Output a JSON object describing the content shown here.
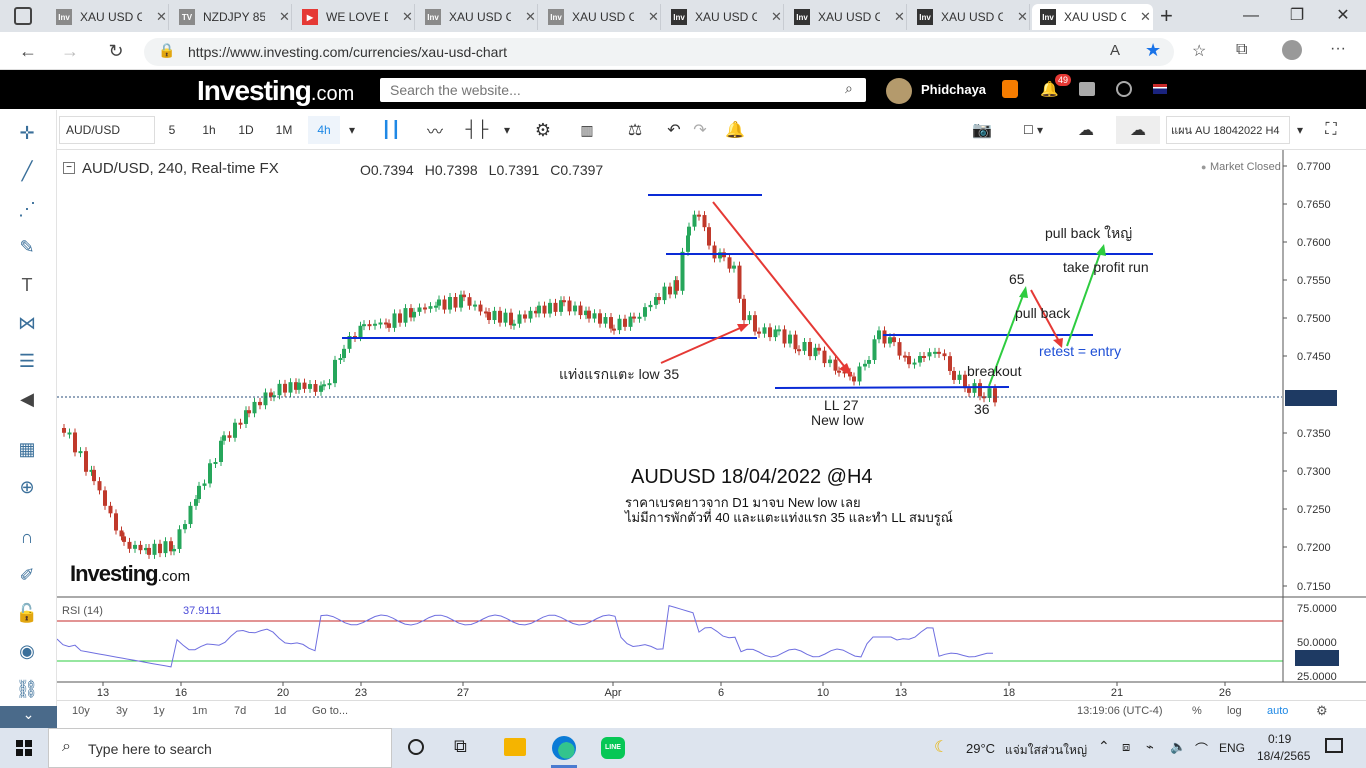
{
  "tabs": [
    {
      "label": "XAU USD C",
      "icon": "inv-icon",
      "color": "#8a8a8a"
    },
    {
      "label": "NZDJPY 85",
      "icon": "tv-icon",
      "color": "#8a8a8a"
    },
    {
      "label": "WE LOVE D",
      "icon": "youtube-icon",
      "color": "#e53935"
    },
    {
      "label": "XAU USD C",
      "icon": "inv-icon",
      "color": "#8a8a8a"
    },
    {
      "label": "XAU USD C",
      "icon": "inv-icon",
      "color": "#8a8a8a"
    },
    {
      "label": "XAU USD C",
      "icon": "inv-icon",
      "color": "#333333"
    },
    {
      "label": "XAU USD C",
      "icon": "inv-icon",
      "color": "#333333"
    },
    {
      "label": "XAU USD C",
      "icon": "inv-icon",
      "color": "#333333"
    },
    {
      "label": "XAU USD C",
      "icon": "inv-icon",
      "color": "#333333"
    }
  ],
  "browser": {
    "url": "https://www.investing.com/currencies/xau-usd-chart"
  },
  "site": {
    "logo_main": "Investing",
    "logo_suffix": ".com",
    "search_placeholder": "Search the website...",
    "username": "Phidchaya",
    "notif_count": "49"
  },
  "toolbar": {
    "symbol": "AUD/USD",
    "intervals": [
      "5",
      "1h",
      "1D",
      "1M",
      "4h"
    ],
    "template": "แผน AU 18042022 H4"
  },
  "legend": {
    "title": "AUD/USD, 240, Real-time FX",
    "open": "O0.7394",
    "high": "H0.7398",
    "low": "L0.7391",
    "close": "C0.7397",
    "market": "Market Closed"
  },
  "rsi": {
    "label": "RSI (14)",
    "value": "37.9111"
  },
  "price_axis": [
    "0.7700",
    "0.7650",
    "0.7600",
    "0.7550",
    "0.7500",
    "0.7450",
    "0.7397",
    "0.7350",
    "0.7300",
    "0.7250",
    "0.7200",
    "0.7150"
  ],
  "rsi_axis": [
    "75.0000",
    "50.0000",
    "37.9111",
    "25.0000"
  ],
  "time_axis": [
    "13",
    "16",
    "20",
    "23",
    "27",
    "Apr",
    "6",
    "10",
    "13",
    "18",
    "21",
    "26"
  ],
  "annotations": {
    "first_touch": "แท่งแรกแตะ low 35",
    "ll27": "LL 27",
    "new_low": "New low",
    "num65": "65",
    "num36": "36",
    "breakout": "breakout",
    "pull_back": "pull back",
    "pull_back_big": "pull back ใหญ่",
    "take_profit": "take profit run",
    "retest": "retest = entry",
    "headline": "AUDUSD 18/04/2022 @H4",
    "line1": "ราคาเบรคยาวจาก D1 มาจบ New low เลย",
    "line2": "ไม่มีการพักตัวที่ 40 และแตะแท่งแรก 35 และทำ LL สมบรูณ์"
  },
  "watermark": {
    "main": "Investing",
    "suffix": ".com"
  },
  "bottom": {
    "ranges": [
      "10y",
      "3y",
      "1y",
      "1m",
      "7d",
      "1d"
    ],
    "goto": "Go to...",
    "clock": "13:19:06 (UTC-4)",
    "pct": "%",
    "log": "log",
    "auto": "auto"
  },
  "taskbar": {
    "search": "Type here to search",
    "weather": "29°C",
    "weather_text": "แจ่มใสส่วนใหญ่",
    "lang": "ENG",
    "time": "0:19",
    "date": "18/4/2565"
  }
}
